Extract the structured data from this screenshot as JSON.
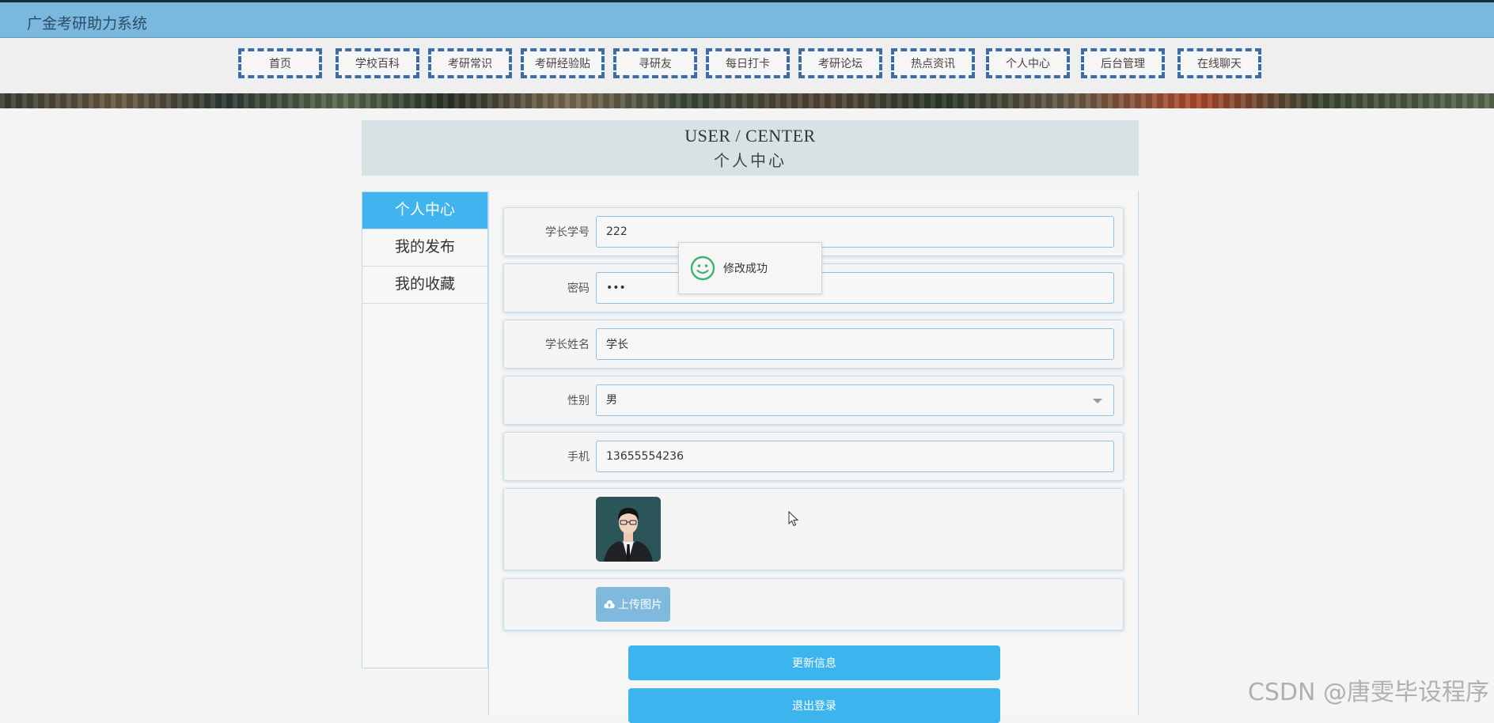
{
  "app": {
    "title": "广金考研助力系统"
  },
  "nav": {
    "items": [
      "首页",
      "学校百科",
      "考研常识",
      "考研经验贴",
      "寻研友",
      "每日打卡",
      "考研论坛",
      "热点资讯",
      "个人中心",
      "后台管理",
      "在线聊天"
    ]
  },
  "section": {
    "title_en": "USER / CENTER",
    "title_cn": "个人中心"
  },
  "sidebar": {
    "items": [
      {
        "label": "个人中心",
        "active": true
      },
      {
        "label": "我的发布",
        "active": false
      },
      {
        "label": "我的收藏",
        "active": false
      }
    ]
  },
  "form": {
    "student_id": {
      "label": "学长学号",
      "value": "222"
    },
    "password": {
      "label": "密码",
      "value": "•••"
    },
    "name": {
      "label": "学长姓名",
      "value": "学长"
    },
    "gender": {
      "label": "性别",
      "value": "男"
    },
    "phone": {
      "label": "手机",
      "value": "13655554236"
    },
    "upload_label": "上传图片",
    "update_button": "更新信息",
    "logout_button": "退出登录"
  },
  "toast": {
    "message": "修改成功"
  },
  "watermark": "CSDN @唐雯毕设程序",
  "colors": {
    "accent": "#3cb4ee",
    "nav_border": "#3d6da6",
    "topbar": "#7ab8de"
  }
}
